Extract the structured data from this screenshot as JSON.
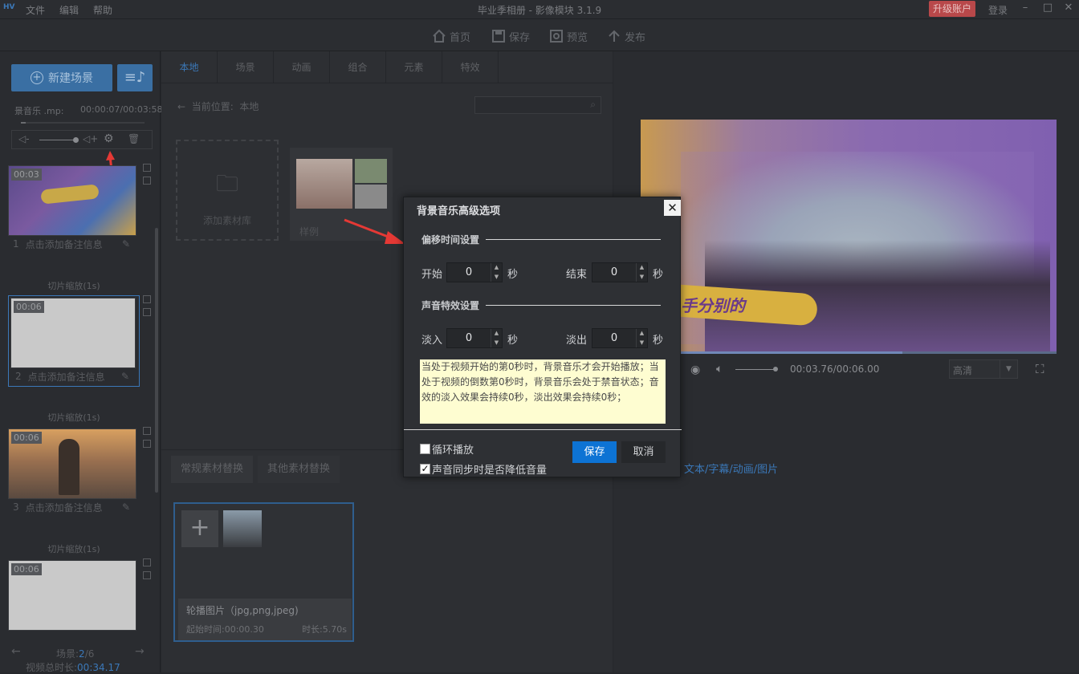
{
  "app": {
    "logo": "HV",
    "title": "毕业季相册 - 影像模块 3.1.9",
    "menu": [
      "文件",
      "编辑",
      "帮助"
    ],
    "upgrade": "升级账户",
    "login": "登录"
  },
  "toolbar": {
    "home": "首页",
    "save": "保存",
    "preview": "预览",
    "publish": "发布"
  },
  "left": {
    "new_scene": "新建场景",
    "music_name": "景音乐 .mp:",
    "music_time": "00:00:07/00:03:58",
    "scenes": [
      {
        "time": "00:03",
        "index": "1",
        "note": "点击添加备注信息"
      },
      {
        "time": "00:06",
        "index": "2",
        "note": "点击添加备注信息"
      },
      {
        "time": "00:06",
        "index": "3",
        "note": "点击添加备注信息"
      },
      {
        "time": "00:06"
      }
    ],
    "transition": "切片缩放(1s)",
    "footer": {
      "scene_label": "场景:",
      "scene_current": "2",
      "scene_total": "/6",
      "total_label": "视频总时长:",
      "total_value": "00:34.17"
    }
  },
  "center": {
    "tabs": [
      "本地",
      "场景",
      "动画",
      "组合",
      "元素",
      "特效"
    ],
    "location_label": "当前位置:",
    "location_value": "本地",
    "add_library": "添加素材库",
    "sample": "样例",
    "replace_tabs": [
      "常规素材替换",
      "其他素材替换"
    ],
    "card": {
      "title": "轮播图片（jpg,png,jpeg)",
      "start": "起始时间:00:00.30",
      "duration": "时长:5.70s"
    }
  },
  "preview": {
    "banner_text": "手分别的",
    "time": "00:03.76/00:06.00",
    "quality": "高清",
    "progress": 0.63,
    "sub_label": "文本/字幕/动画/图片"
  },
  "dialog": {
    "title": "背景音乐高级选项",
    "close": "✕",
    "section1": "偏移时间设置",
    "start_label": "开始",
    "start_value": "0",
    "end_label": "结束",
    "end_value": "0",
    "unit": "秒",
    "section2": "声音特效设置",
    "fadein_label": "淡入",
    "fadein_value": "0",
    "fadeout_label": "淡出",
    "fadeout_value": "0",
    "note": "当处于视频开始的第0秒时，背景音乐才会开始播放；当处于视频的倒数第0秒时，背景音乐会处于禁音状态；音效的淡入效果会持续0秒，淡出效果会持续0秒；",
    "loop_label": "循环播放",
    "duck_label": "声音同步时是否降低音量",
    "loop_checked": false,
    "duck_checked": true,
    "save": "保存",
    "cancel": "取消"
  },
  "colors": {
    "accent": "#3b78b8",
    "dialog_button": "#0d73d4",
    "note_bg": "#fefdd1",
    "annotation": "#e53935"
  }
}
